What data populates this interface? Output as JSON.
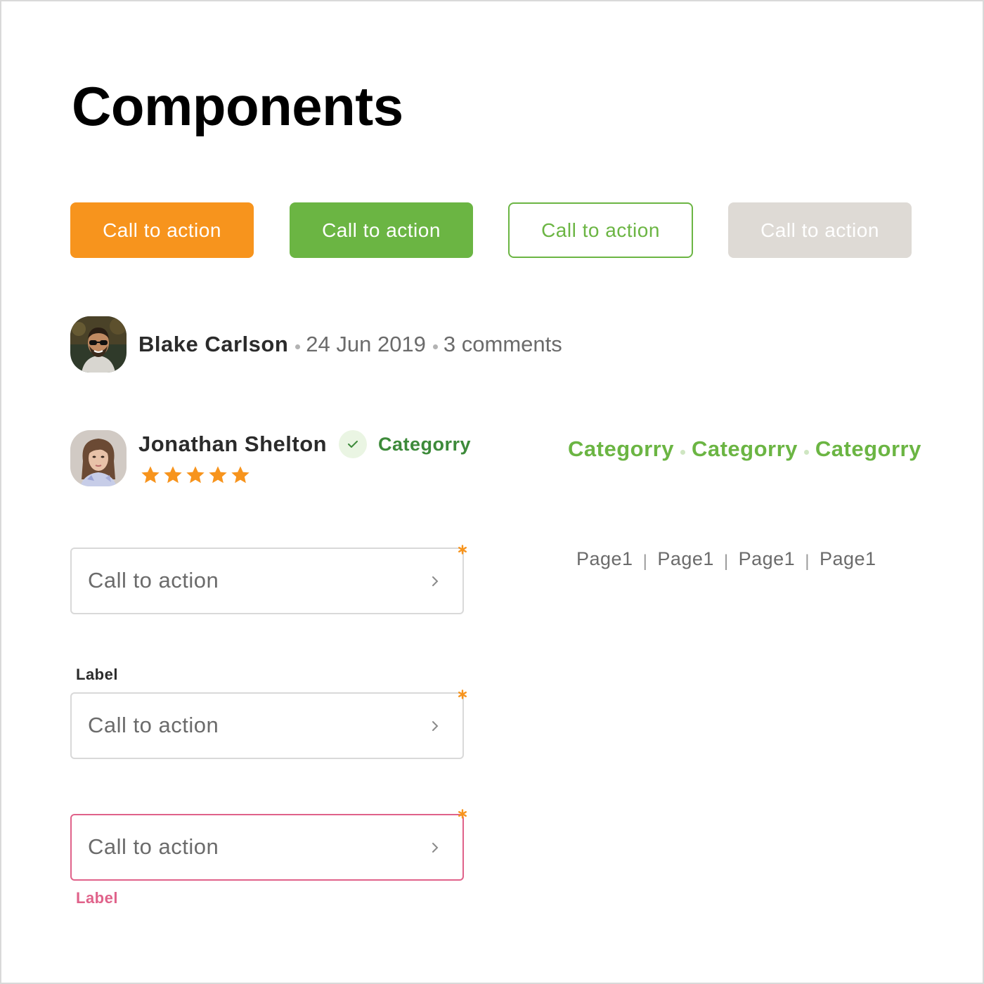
{
  "title": "Components",
  "buttons": {
    "primary_label": "Call to action",
    "secondary_label": "Call to action",
    "outline_label": "Call to action",
    "disabled_label": "Call to action"
  },
  "post_meta": {
    "author": "Blake Carlson",
    "date": "24 Jun 2019",
    "comments": "3 comments"
  },
  "review": {
    "author": "Jonathan Shelton",
    "category": "Categorry",
    "rating": 5,
    "rating_max": 5
  },
  "categories": [
    "Categorry",
    "Categorry",
    "Categorry"
  ],
  "pagination": [
    "Page1",
    "Page1",
    "Page1",
    "Page1"
  ],
  "fields": [
    {
      "value": "Call to action",
      "required": true,
      "label": "",
      "state": "default"
    },
    {
      "value": "Call to action",
      "required": true,
      "label": "Label",
      "state": "default"
    },
    {
      "value": "Call to action",
      "required": true,
      "label": "Label",
      "state": "error"
    }
  ],
  "colors": {
    "orange": "#f7941d",
    "green": "#6bb543",
    "disabled": "#dedad5",
    "error": "#e0628a"
  },
  "icons": {
    "chevron": "chevron-right-icon",
    "check": "check-icon",
    "star": "star-icon",
    "required": "asterisk-icon"
  }
}
